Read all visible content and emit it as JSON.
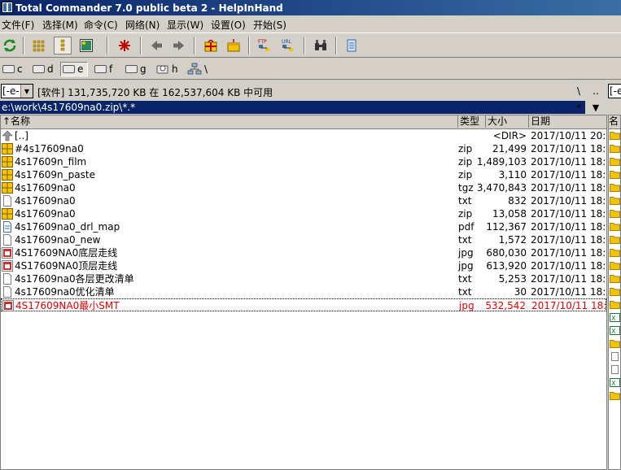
{
  "window": {
    "title": "Total Commander 7.0 public beta 2 - HelpInHand"
  },
  "menu": [
    "文件(F)",
    "选择(M)",
    "命令(C)",
    "网络(N)",
    "显示(W)",
    "设置(O)",
    "开始(S)"
  ],
  "toolbar": {
    "buttons": [
      "refresh-icon",
      "brief-view-icon",
      "tree-view-icon",
      "thumbnail-icon",
      "invert-selection-icon",
      "back-icon",
      "forward-icon",
      "pack-icon",
      "unpack-icon",
      "ftp-connect-icon",
      "url-download-icon",
      "find-icon",
      "notepad-icon"
    ],
    "ftp_label": "FTP",
    "url_label": "URL"
  },
  "drives": [
    {
      "letter": "c",
      "selected": false
    },
    {
      "letter": "d",
      "selected": false
    },
    {
      "letter": "e",
      "selected": true
    },
    {
      "letter": "f",
      "selected": false
    },
    {
      "letter": "g",
      "selected": false
    },
    {
      "letter": "h",
      "selected": false
    },
    {
      "letter": "\\",
      "selected": false
    }
  ],
  "left_panel": {
    "drive_combo": "[-e-]",
    "free_space": "[软件]  131,735,720 KB 在 162,537,604 KB 中可用",
    "root_btn": "\\",
    "up_btn": "..",
    "path": "e:\\work\\4s17609na0.zip\\*.*",
    "path_star": "*",
    "path_dropdown": "▼",
    "columns": {
      "name": "↑名称",
      "ext": "类型",
      "size": "大小",
      "date": "日期"
    },
    "files": [
      {
        "name": "[..]",
        "ext": "",
        "size": "<DIR>",
        "date": "2017/10/11 20:",
        "icon": "up-dir-icon",
        "selected": false
      },
      {
        "name": "#4s17609na0",
        "ext": "zip",
        "size": "21,499",
        "date": "2017/10/11 18:",
        "icon": "archive-icon",
        "selected": false
      },
      {
        "name": "4s17609n_film",
        "ext": "zip",
        "size": "1,489,103",
        "date": "2017/10/11 18:",
        "icon": "archive-icon",
        "selected": false
      },
      {
        "name": "4s17609n_paste",
        "ext": "zip",
        "size": "3,110",
        "date": "2017/10/11 18:",
        "icon": "archive-icon",
        "selected": false
      },
      {
        "name": "4s17609na0",
        "ext": "tgz",
        "size": "3,470,843",
        "date": "2017/10/11 18:",
        "icon": "archive-icon",
        "selected": false
      },
      {
        "name": "4s17609na0",
        "ext": "txt",
        "size": "832",
        "date": "2017/10/11 18:",
        "icon": "text-file-icon",
        "selected": false
      },
      {
        "name": "4s17609na0",
        "ext": "zip",
        "size": "13,058",
        "date": "2017/10/11 18:",
        "icon": "archive-icon",
        "selected": false
      },
      {
        "name": "4s17609na0_drl_map",
        "ext": "pdf",
        "size": "112,367",
        "date": "2017/10/11 18:",
        "icon": "document-icon",
        "selected": false
      },
      {
        "name": "4s17609na0_new",
        "ext": "txt",
        "size": "1,572",
        "date": "2017/10/11 18:",
        "icon": "text-file-icon",
        "selected": false
      },
      {
        "name": "4S17609NA0底层走线",
        "ext": "jpg",
        "size": "680,030",
        "date": "2017/10/11 18:",
        "icon": "image-file-icon",
        "selected": false
      },
      {
        "name": "4S17609NA0顶层走线",
        "ext": "jpg",
        "size": "613,920",
        "date": "2017/10/11 18:",
        "icon": "image-file-icon",
        "selected": false
      },
      {
        "name": "4s17609na0各层更改清单",
        "ext": "txt",
        "size": "5,253",
        "date": "2017/10/11 18:",
        "icon": "text-file-icon",
        "selected": false
      },
      {
        "name": "4s17609na0优化清单",
        "ext": "txt",
        "size": "30",
        "date": "2017/10/11 18:",
        "icon": "text-file-icon",
        "selected": false
      },
      {
        "name": "4S17609NA0最小SMT",
        "ext": "jpg",
        "size": "532,542",
        "date": "2017/10/11 18:",
        "icon": "image-file-icon",
        "selected": true
      }
    ]
  },
  "right_panel": {
    "drive_combo": "[-e",
    "column_name": "名"
  },
  "colors": {
    "title_start": "#0a246a",
    "title_end": "#3a6ea5",
    "selected_text": "#e00000",
    "archive_yellow": "#f5c400"
  }
}
